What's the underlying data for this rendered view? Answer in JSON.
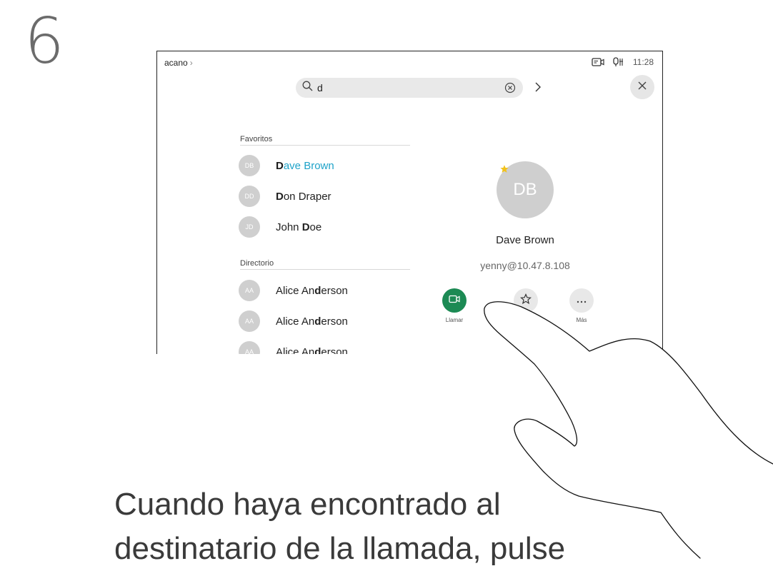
{
  "step_number": "6",
  "device": {
    "breadcrumb": "acano",
    "status": {
      "time": "11:28"
    },
    "search": {
      "query": "d"
    },
    "favorites": {
      "title": "Favoritos",
      "contacts": [
        {
          "initials": "DB",
          "name_pre": "",
          "name_match": "D",
          "name_post": "ave Brown",
          "selected": true
        },
        {
          "initials": "DD",
          "name_pre": "",
          "name_match": "D",
          "name_post": "on Draper"
        },
        {
          "initials": "JD",
          "name_pre": "John ",
          "name_match": "D",
          "name_post": "oe"
        }
      ]
    },
    "directory": {
      "title": "Directorio",
      "contacts": [
        {
          "initials": "AA",
          "name_pre": "Alice An",
          "name_match": "d",
          "name_post": "erson"
        },
        {
          "initials": "AA",
          "name_pre": "Alice An",
          "name_match": "d",
          "name_post": "erson"
        },
        {
          "initials": "AA",
          "name_pre": "Alice An",
          "name_match": "d",
          "name_post": "erson"
        }
      ]
    },
    "detail": {
      "initials": "DB",
      "name": "Dave Brown",
      "address": "yenny@10.47.8.108",
      "actions": {
        "call": "Llamar",
        "favorite": "",
        "more": "Más"
      }
    },
    "colors": {
      "call_green": "#1c8a54",
      "highlight_blue": "#1fa3c9",
      "avatar_gray": "#cfcfcf",
      "star_yellow": "#f2c21b"
    }
  },
  "instruction": {
    "line1": "Cuando haya encontrado al",
    "line2": "destinatario de la llamada, pulse"
  }
}
